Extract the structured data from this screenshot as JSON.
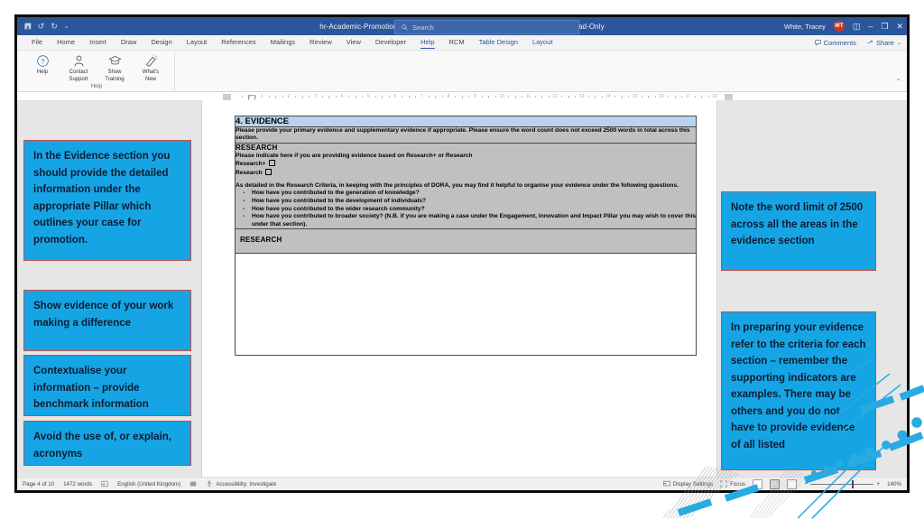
{
  "titlebar": {
    "filename": "hr-Academic-Promotion-Application-Form-applications-to-grades-7-9.docx  -  Read-Only",
    "readonly_caret": "⌄",
    "search_placeholder": "Search",
    "search_icon": "search-icon",
    "user_name": "White, Tracey",
    "user_initials": "WT",
    "save_icon": "save-icon",
    "undo_icon": "undo-icon",
    "redo_icon": "redo-icon",
    "qat_more_icon": "chevron-down-icon",
    "ribbon_display_icon": "ribbon-display-options-icon",
    "minimize_icon": "–",
    "restore_icon": "❐",
    "close_icon": "✕"
  },
  "ribbon": {
    "tabs": [
      {
        "label": "File",
        "state": "normal"
      },
      {
        "label": "Home",
        "state": "normal"
      },
      {
        "label": "Insert",
        "state": "normal"
      },
      {
        "label": "Draw",
        "state": "normal"
      },
      {
        "label": "Design",
        "state": "normal"
      },
      {
        "label": "Layout",
        "state": "normal"
      },
      {
        "label": "References",
        "state": "normal"
      },
      {
        "label": "Mailings",
        "state": "normal"
      },
      {
        "label": "Review",
        "state": "normal"
      },
      {
        "label": "View",
        "state": "normal"
      },
      {
        "label": "Developer",
        "state": "normal"
      },
      {
        "label": "Help",
        "state": "active"
      },
      {
        "label": "RCM",
        "state": "normal"
      },
      {
        "label": "Table Design",
        "state": "contextual"
      },
      {
        "label": "Layout",
        "state": "contextual"
      }
    ],
    "comments_label": "Comments",
    "comments_icon": "comment-icon",
    "share_label": "Share",
    "share_icon": "share-icon",
    "share_caret": "⌄",
    "collapse_icon": "⌃",
    "group_name": "Help",
    "buttons": [
      {
        "label_line1": "Help",
        "label_line2": "",
        "icon": "question-mark-circle-icon"
      },
      {
        "label_line1": "Contact",
        "label_line2": "Support",
        "icon": "person-icon"
      },
      {
        "label_line1": "Show",
        "label_line2": "Training",
        "icon": "graduation-cap-icon"
      },
      {
        "label_line1": "What's",
        "label_line2": "New",
        "icon": "megaphone-icon"
      }
    ]
  },
  "ruler": {
    "numbers": [
      "1",
      "2",
      "3",
      "4",
      "5",
      "6",
      "7",
      "8",
      "9",
      "10",
      "11",
      "12",
      "13",
      "14",
      "15",
      "16",
      "17",
      "18"
    ]
  },
  "document": {
    "section_heading": "4. EVIDENCE",
    "intro": "Please provide your primary evidence and supplementary evidence if appropriate.  Please ensure the word count does not exceed 2500 words in total across this section.",
    "research_heading": "RESEARCH",
    "research_indicate": "Please indicate here if you are providing evidence based on Research+ or Research",
    "option_research_plus": "Research+",
    "option_research": "Research",
    "dora_paragraph": "As detailed in the Research Criteria, in keeping with the principles of DORA, you may find it helpful to organise your evidence under the following questions.",
    "questions": [
      "How have you contributed to the generation of knowledge?",
      "How have you contributed to the development of individuals?",
      "How have you contributed to the wider research community?",
      "How have you contributed to broader society? (N.B. if you are making a case under the Engagement, Innovation and Impact Pillar you may wish to cover this under that section)."
    ],
    "research_row_heading": "RESEARCH"
  },
  "statusbar": {
    "page": "Page 4 of 10",
    "words": "1472 words",
    "proofing_icon": "proofing-errors-icon",
    "language": "English (United Kingdom)",
    "track_changes_icon": "track-changes-icon",
    "accessibility_icon": "accessibility-icon",
    "accessibility": "Accessibility: Investigate",
    "display_settings_icon": "display-settings-icon",
    "display_settings": "Display Settings",
    "focus_icon": "focus-icon",
    "focus": "Focus",
    "view_read_icon": "read-mode-icon",
    "view_print_icon": "print-layout-icon",
    "view_web_icon": "web-layout-icon",
    "zoom_out": "−",
    "zoom_in": "+",
    "zoom_level": "140%"
  },
  "callouts": [
    {
      "id": "callout-evidence-section",
      "text": "In the Evidence section you should provide the detailed information under the appropriate Pillar which outlines your case for promotion."
    },
    {
      "id": "callout-show-evidence",
      "text": "Show evidence of your work making a difference"
    },
    {
      "id": "callout-contextualise",
      "text": "Contextualise your information – provide benchmark information"
    },
    {
      "id": "callout-acronyms",
      "text": "Avoid the use of, or explain, acronyms"
    },
    {
      "id": "callout-word-limit",
      "text": "Note the word limit of 2500 across all the areas in the evidence section"
    },
    {
      "id": "callout-criteria",
      "text": "In preparing your evidence refer to the criteria for each section – remember the supporting indicators are examples.  There may be others and you do not have to provide evidence of all listed"
    }
  ],
  "colors": {
    "callout_fill": "#16a5e4",
    "callout_border": "#c0504d",
    "title_bar": "#2b579a",
    "table_header": "#b9d3ee",
    "table_gray": "#c0c0c0",
    "accent_cyan": "#29abe2"
  }
}
